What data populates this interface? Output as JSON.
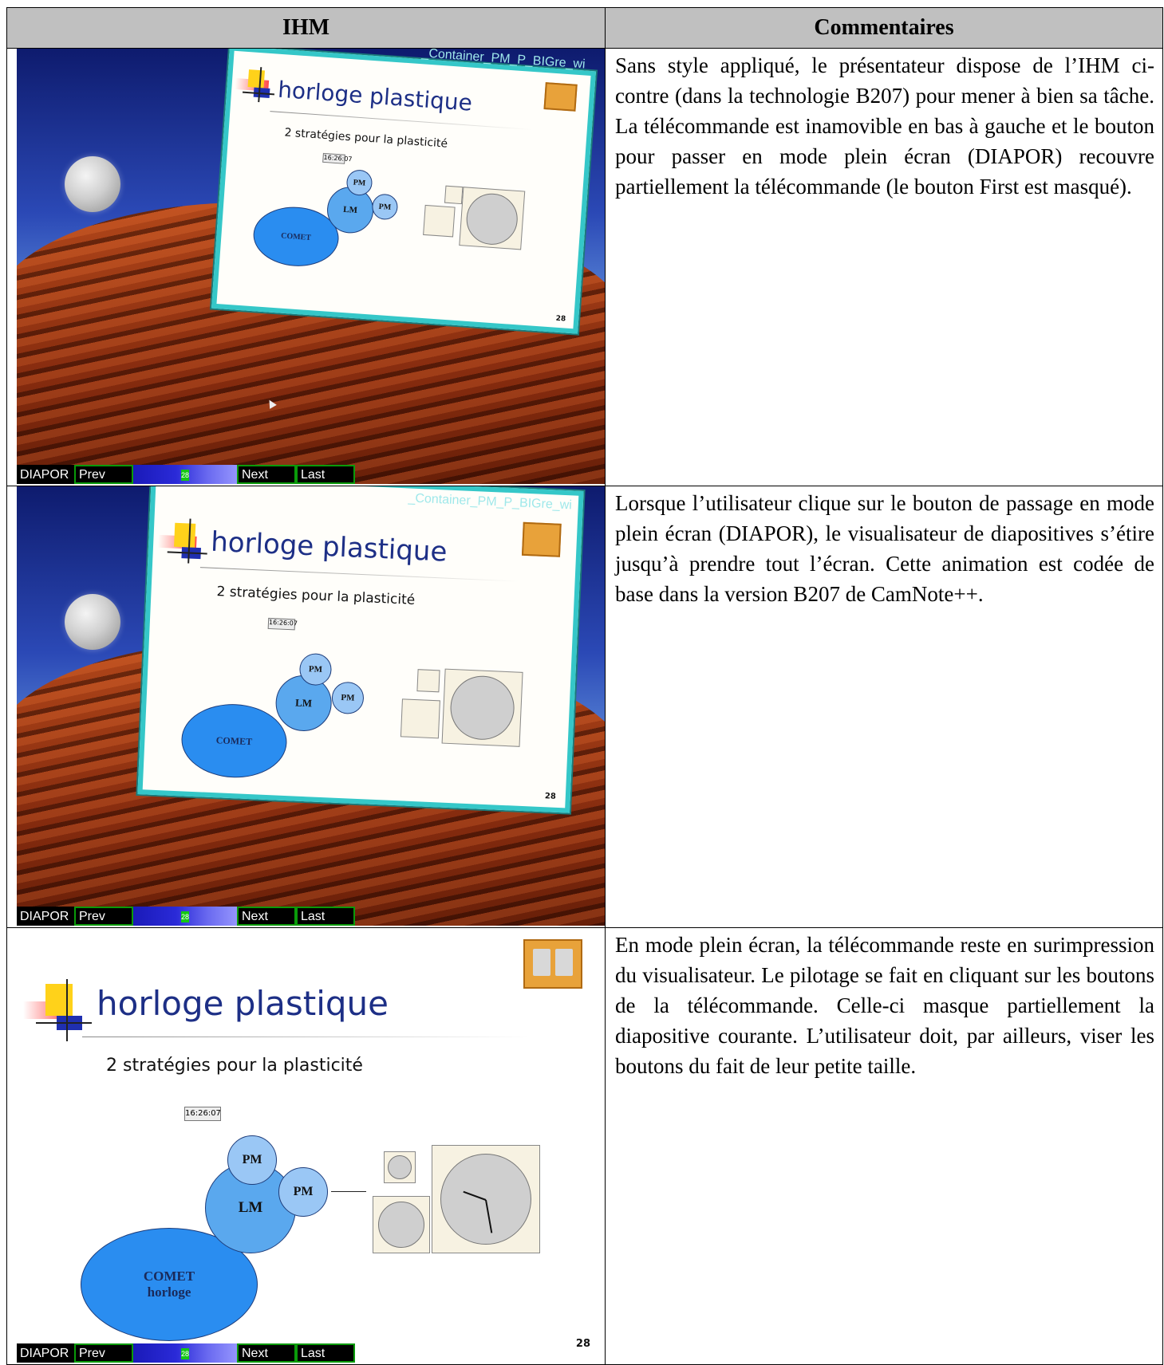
{
  "header": {
    "col1": "IHM",
    "col2": "Commentaires"
  },
  "slide": {
    "container_title": "_Container_PM_P_BIGre_wi",
    "title": "horloge plastique",
    "subtitle": "2 stratégies pour la plasticité",
    "clock_time": "16:26:07",
    "pm1": "PM",
    "pm2": "PM",
    "lm": "LM",
    "comet_line1": "COMET",
    "comet_line2": "horloge",
    "page": "28"
  },
  "remote": {
    "diapor": "DIAPOR",
    "prev": "Prev",
    "page": "28",
    "next": "Next",
    "last": "Last"
  },
  "rows": [
    {
      "comment": "Sans style appliqué, le présentateur dispose de l’IHM ci-contre (dans la technologie B207) pour mener à bien sa tâche. La télécommande est inamovible en bas à gauche et le bouton pour passer en mode plein écran (DIAPOR) recouvre partiellement la télécommande (le bouton First est masqué)."
    },
    {
      "comment": "Lorsque l’utilisateur clique sur le bouton de passage en mode plein écran (DIAPOR), le visualisateur de diapositives s’étire jusqu’à prendre tout l’écran. Cette animation est codée de base dans la version B207 de CamNote++."
    },
    {
      "comment": "En mode plein écran, la télécommande reste en surimpression du visualisateur. Le pilotage se fait en cliquant sur les boutons de la télécommande. Celle-ci masque partiellement la diapositive courante. L’utilisateur doit, par ailleurs, viser les boutons du fait de leur petite taille."
    }
  ]
}
